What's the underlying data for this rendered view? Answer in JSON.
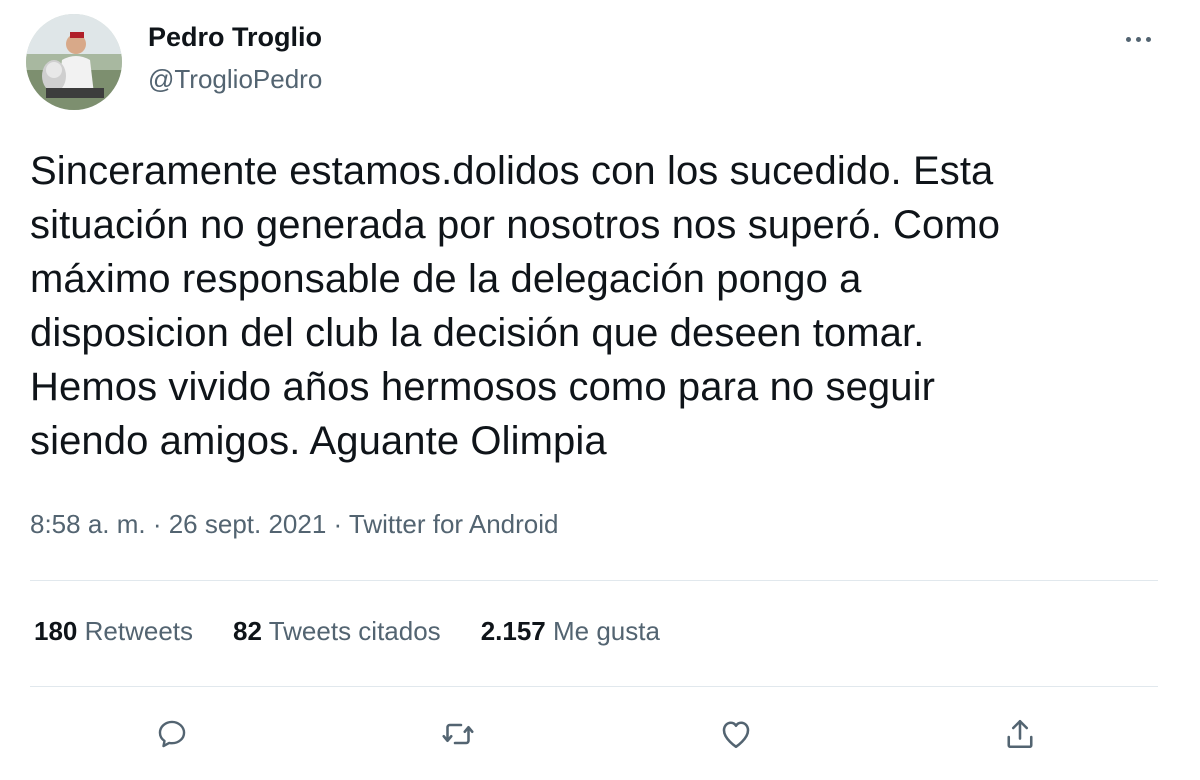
{
  "author": {
    "display_name": "Pedro Troglio",
    "handle": "@TroglioPedro",
    "avatar_icon": "profile-photo"
  },
  "tweet": {
    "lines": [
      "Sinceramente estamos.dolidos con los sucedido. Esta",
      "situación no generada por nosotros nos superó. Como",
      "máximo responsable de la delegación pongo a",
      "disposicion del club la decisión que deseen tomar.",
      "Hemos vivido años hermosos como para no seguir",
      "siendo amigos. Aguante Olimpia"
    ],
    "meta": "8:58 a. m. · 26 sept. 2021 · Twitter for Android"
  },
  "stats": {
    "retweets": {
      "num": "180",
      "label": "Retweets"
    },
    "quotes": {
      "num": "82",
      "label": "Tweets citados"
    },
    "likes": {
      "num": "2.157",
      "label": "Me gusta"
    }
  },
  "actions": {
    "reply_icon": "reply-icon",
    "retweet_icon": "retweet-icon",
    "like_icon": "heart-icon",
    "share_icon": "share-icon"
  },
  "colors": {
    "text": "#0f1419",
    "secondary": "#536471",
    "divider": "#e1e8ed"
  }
}
